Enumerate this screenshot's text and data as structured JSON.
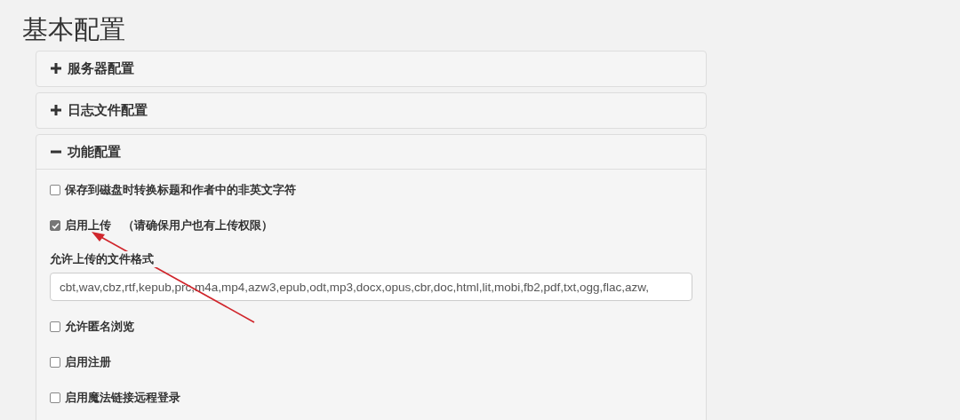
{
  "title": "基本配置",
  "panels": [
    {
      "title": "服务器配置",
      "expanded": false
    },
    {
      "title": "日志文件配置",
      "expanded": false
    },
    {
      "title": "功能配置",
      "expanded": true,
      "fields": [
        {
          "kind": "checkbox",
          "label": "保存到磁盘时转换标题和作者中的非英文字符",
          "checked": false
        },
        {
          "kind": "checkbox",
          "label": "启用上传",
          "note": "（请确保用户也有上传权限）",
          "checked": true
        },
        {
          "kind": "text",
          "label": "允许上传的文件格式",
          "value": "cbt,wav,cbz,rtf,kepub,prc,m4a,mp4,azw3,epub,odt,mp3,docx,opus,cbr,doc,html,lit,mobi,fb2,pdf,txt,ogg,flac,azw,"
        },
        {
          "kind": "checkbox",
          "label": "允许匿名浏览",
          "checked": false
        },
        {
          "kind": "checkbox",
          "label": "启用注册",
          "checked": false
        },
        {
          "kind": "checkbox",
          "label": "启用魔法链接远程登录",
          "checked": false
        }
      ]
    }
  ]
}
